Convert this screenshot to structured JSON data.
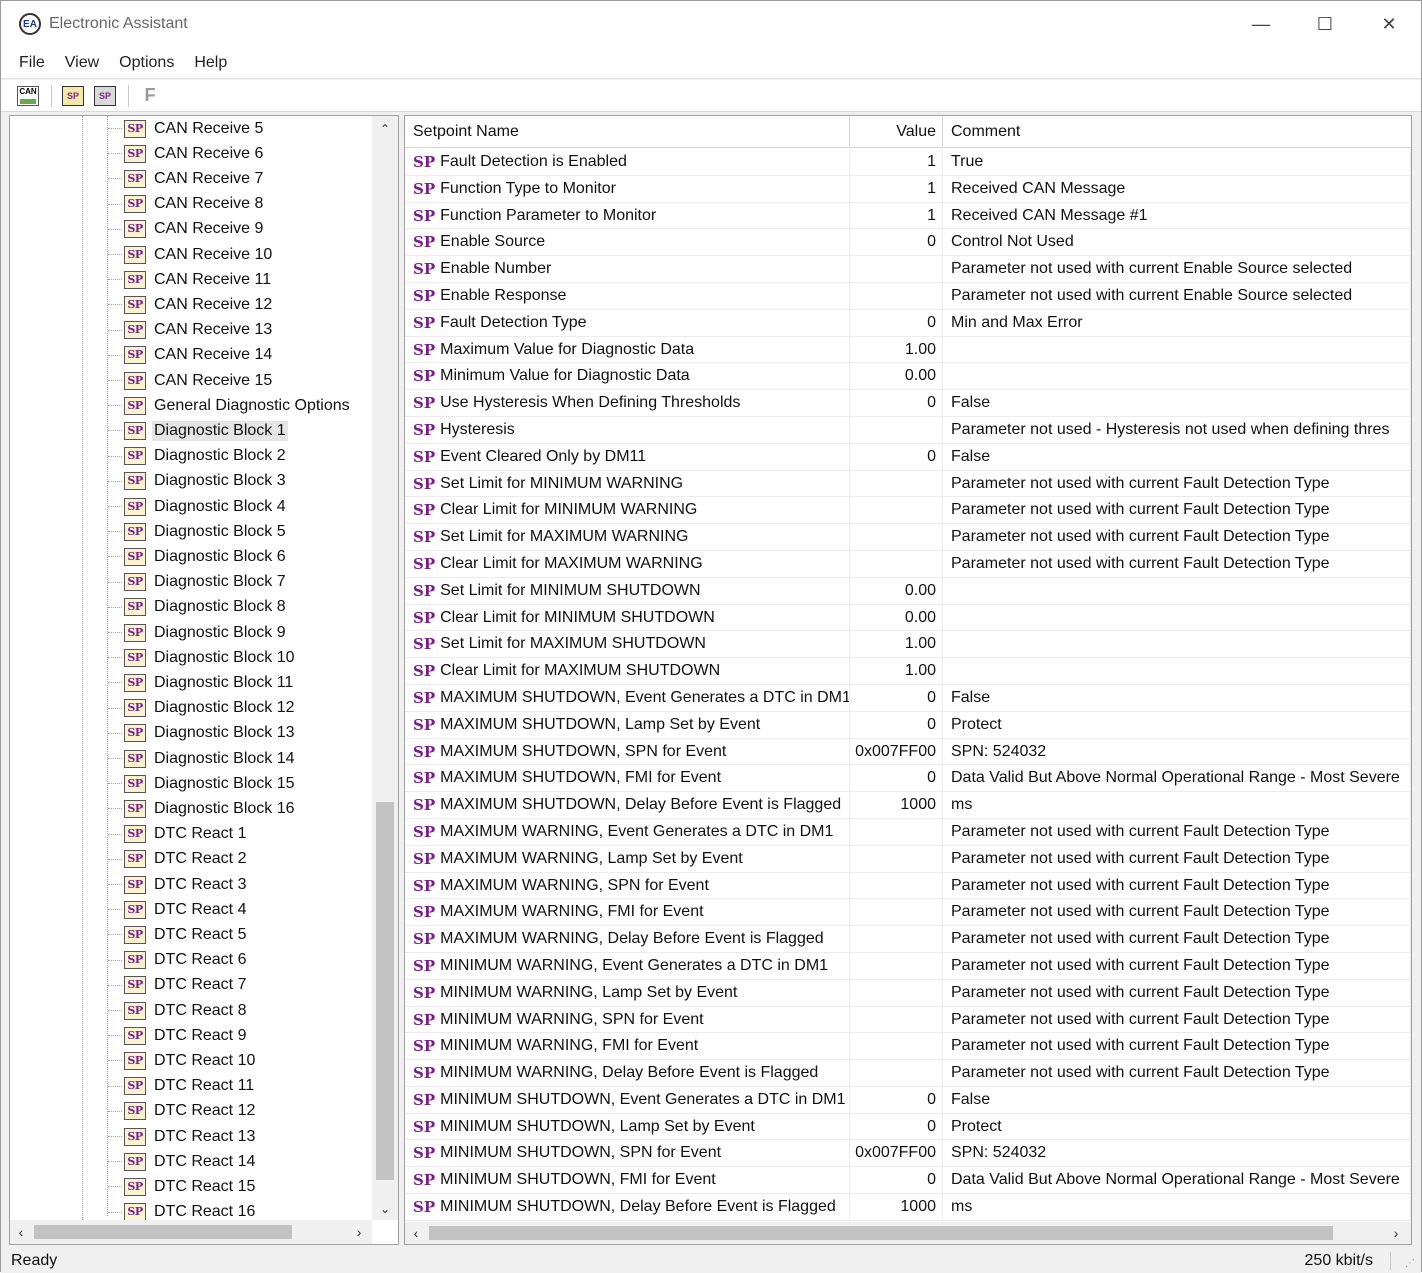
{
  "window": {
    "title": "Electronic Assistant",
    "minimize": "—",
    "maximize": "☐",
    "close": "✕"
  },
  "menu": [
    "File",
    "View",
    "Options",
    "Help"
  ],
  "toolbar": {
    "f_label": "F"
  },
  "tree": {
    "icon_text": "SP",
    "selected_index": 12,
    "items": [
      "CAN Receive 5",
      "CAN Receive 6",
      "CAN Receive 7",
      "CAN Receive 8",
      "CAN Receive 9",
      "CAN Receive 10",
      "CAN Receive 11",
      "CAN Receive 12",
      "CAN Receive 13",
      "CAN Receive 14",
      "CAN Receive 15",
      "General Diagnostic Options",
      "Diagnostic Block 1",
      "Diagnostic Block 2",
      "Diagnostic Block 3",
      "Diagnostic Block 4",
      "Diagnostic Block 5",
      "Diagnostic Block 6",
      "Diagnostic Block 7",
      "Diagnostic Block 8",
      "Diagnostic Block 9",
      "Diagnostic Block 10",
      "Diagnostic Block 11",
      "Diagnostic Block 12",
      "Diagnostic Block 13",
      "Diagnostic Block 14",
      "Diagnostic Block 15",
      "Diagnostic Block 16",
      "DTC React 1",
      "DTC React 2",
      "DTC React 3",
      "DTC React 4",
      "DTC React 5",
      "DTC React 6",
      "DTC React 7",
      "DTC React 8",
      "DTC React 9",
      "DTC React 10",
      "DTC React 11",
      "DTC React 12",
      "DTC React 13",
      "DTC React 14",
      "DTC React 15",
      "DTC React 16"
    ]
  },
  "grid": {
    "columns": {
      "name": "Setpoint Name",
      "value": "Value",
      "comment": "Comment"
    },
    "sp_tag": "SP",
    "rows": [
      {
        "name": "Fault Detection is Enabled",
        "value": "1",
        "comment": "True"
      },
      {
        "name": "Function Type to Monitor",
        "value": "1",
        "comment": "Received CAN Message"
      },
      {
        "name": "Function Parameter to Monitor",
        "value": "1",
        "comment": "Received CAN Message #1"
      },
      {
        "name": "Enable Source",
        "value": "0",
        "comment": "Control Not Used"
      },
      {
        "name": "Enable Number",
        "value": "",
        "comment": "Parameter not used with current Enable Source selected"
      },
      {
        "name": "Enable Response",
        "value": "",
        "comment": "Parameter not used with current Enable Source selected"
      },
      {
        "name": "Fault Detection Type",
        "value": "0",
        "comment": "Min and Max Error"
      },
      {
        "name": "Maximum Value for Diagnostic Data",
        "value": "1.00",
        "comment": ""
      },
      {
        "name": "Minimum Value for Diagnostic Data",
        "value": "0.00",
        "comment": ""
      },
      {
        "name": "Use Hysteresis When Defining Thresholds",
        "value": "0",
        "comment": "False"
      },
      {
        "name": "Hysteresis",
        "value": "",
        "comment": "Parameter not used - Hysteresis not used when defining thres"
      },
      {
        "name": "Event Cleared Only by DM11",
        "value": "0",
        "comment": "False"
      },
      {
        "name": "Set Limit for MINIMUM WARNING",
        "value": "",
        "comment": "Parameter not used with current Fault Detection Type"
      },
      {
        "name": "Clear Limit for MINIMUM WARNING",
        "value": "",
        "comment": "Parameter not used with current Fault Detection Type"
      },
      {
        "name": "Set Limit for MAXIMUM WARNING",
        "value": "",
        "comment": "Parameter not used with current Fault Detection Type"
      },
      {
        "name": "Clear Limit for MAXIMUM WARNING",
        "value": "",
        "comment": "Parameter not used with current Fault Detection Type"
      },
      {
        "name": "Set Limit for MINIMUM SHUTDOWN",
        "value": "0.00",
        "comment": ""
      },
      {
        "name": "Clear Limit for MINIMUM SHUTDOWN",
        "value": "0.00",
        "comment": ""
      },
      {
        "name": "Set Limit for MAXIMUM SHUTDOWN",
        "value": "1.00",
        "comment": ""
      },
      {
        "name": "Clear Limit for MAXIMUM SHUTDOWN",
        "value": "1.00",
        "comment": ""
      },
      {
        "name": "MAXIMUM SHUTDOWN, Event Generates a DTC in DM1",
        "value": "0",
        "comment": "False"
      },
      {
        "name": "MAXIMUM SHUTDOWN, Lamp Set by Event",
        "value": "0",
        "comment": "Protect"
      },
      {
        "name": "MAXIMUM SHUTDOWN, SPN for Event",
        "value": "0x007FF00",
        "comment": "SPN: 524032"
      },
      {
        "name": "MAXIMUM SHUTDOWN, FMI for Event",
        "value": "0",
        "comment": "Data Valid But Above Normal Operational Range - Most Severe"
      },
      {
        "name": "MAXIMUM SHUTDOWN, Delay Before Event is Flagged",
        "value": "1000",
        "comment": "ms"
      },
      {
        "name": "MAXIMUM WARNING, Event Generates a DTC in DM1",
        "value": "",
        "comment": "Parameter not used with current Fault Detection Type"
      },
      {
        "name": "MAXIMUM WARNING, Lamp Set by Event",
        "value": "",
        "comment": "Parameter not used with current Fault Detection Type"
      },
      {
        "name": "MAXIMUM WARNING, SPN for Event",
        "value": "",
        "comment": "Parameter not used with current Fault Detection Type"
      },
      {
        "name": "MAXIMUM WARNING, FMI for Event",
        "value": "",
        "comment": "Parameter not used with current Fault Detection Type"
      },
      {
        "name": "MAXIMUM WARNING, Delay Before Event is Flagged",
        "value": "",
        "comment": "Parameter not used with current Fault Detection Type"
      },
      {
        "name": "MINIMUM WARNING, Event Generates a DTC in DM1",
        "value": "",
        "comment": "Parameter not used with current Fault Detection Type"
      },
      {
        "name": "MINIMUM WARNING, Lamp Set by Event",
        "value": "",
        "comment": "Parameter not used with current Fault Detection Type"
      },
      {
        "name": "MINIMUM WARNING, SPN for Event",
        "value": "",
        "comment": "Parameter not used with current Fault Detection Type"
      },
      {
        "name": "MINIMUM WARNING, FMI for Event",
        "value": "",
        "comment": "Parameter not used with current Fault Detection Type"
      },
      {
        "name": "MINIMUM WARNING, Delay Before Event is Flagged",
        "value": "",
        "comment": "Parameter not used with current Fault Detection Type"
      },
      {
        "name": "MINIMUM SHUTDOWN, Event Generates a DTC in DM1",
        "value": "0",
        "comment": "False"
      },
      {
        "name": "MINIMUM SHUTDOWN, Lamp Set by Event",
        "value": "0",
        "comment": "Protect"
      },
      {
        "name": "MINIMUM SHUTDOWN, SPN for Event",
        "value": "0x007FF00",
        "comment": "SPN: 524032"
      },
      {
        "name": "MINIMUM SHUTDOWN, FMI for Event",
        "value": "0",
        "comment": "Data Valid But Above Normal Operational Range - Most Severe"
      },
      {
        "name": "MINIMUM SHUTDOWN, Delay Before Event is Flagged",
        "value": "1000",
        "comment": "ms"
      }
    ]
  },
  "status": {
    "left": "Ready",
    "right": "250 kbit/s"
  },
  "colors": {
    "sp_purple": "#7a1e8c",
    "selection": "#e5e5e5"
  }
}
